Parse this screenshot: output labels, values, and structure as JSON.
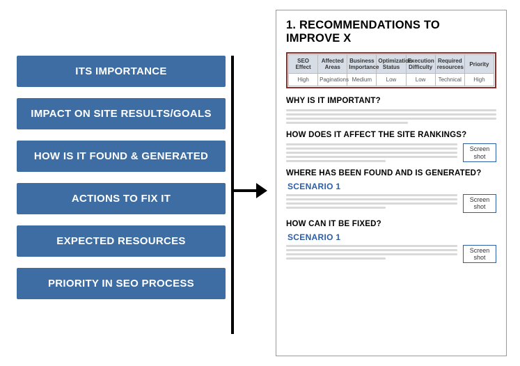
{
  "left_items": [
    "ITS IMPORTANCE",
    "IMPACT ON SITE RESULTS/GOALS",
    "HOW IS IT FOUND & GENERATED",
    "ACTIONS TO FIX IT",
    "EXPECTED RESOURCES",
    "PRIORITY IN SEO PROCESS"
  ],
  "doc": {
    "title": "1. RECOMMENDATIONS TO IMPROVE X",
    "table": {
      "headers": [
        "SEO Effect",
        "Affected Areas",
        "Business Importance",
        "Optimization Status",
        "Execution Difficulty",
        "Required resources",
        "Priority"
      ],
      "row": [
        "High",
        "Paginations",
        "Medium",
        "Low",
        "Low",
        "Technical",
        "High"
      ]
    },
    "sections": {
      "s1": "WHY IS IT IMPORTANT?",
      "s2": "HOW DOES IT AFFECT THE SITE RANKINGS?",
      "s3": "WHERE HAS BEEN FOUND AND IS GENERATED?",
      "s4": "HOW CAN IT BE FIXED?"
    },
    "scenario_label": "SCENARIO 1",
    "screenshot_l1": "Screen",
    "screenshot_l2": "shot"
  }
}
